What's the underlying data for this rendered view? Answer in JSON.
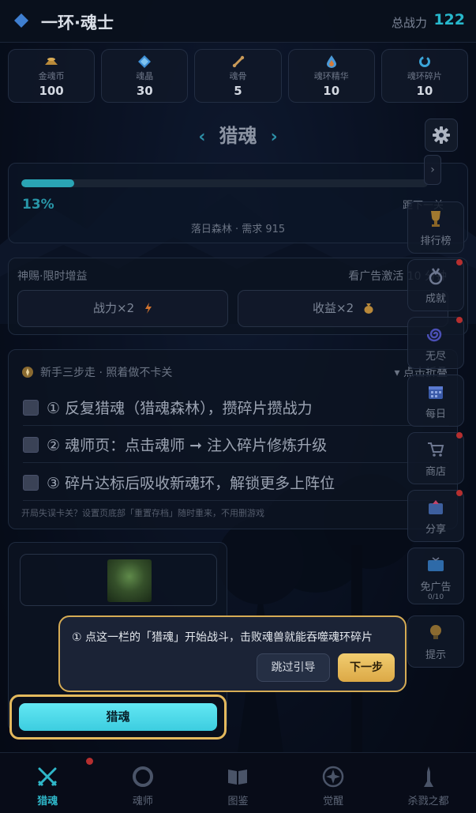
{
  "header": {
    "title": "一环·魂士",
    "power_label": "总战力",
    "power_value": "122"
  },
  "resources": [
    {
      "label": "金魂币",
      "value": "100",
      "icon": "coin-pile-icon"
    },
    {
      "label": "魂晶",
      "value": "30",
      "icon": "crystal-icon"
    },
    {
      "label": "魂骨",
      "value": "5",
      "icon": "bone-icon"
    },
    {
      "label": "魂环精华",
      "value": "10",
      "icon": "essence-drop-icon"
    },
    {
      "label": "魂环碎片",
      "value": "10",
      "icon": "ring-fragment-icon"
    }
  ],
  "hunt": {
    "title": "猎魂",
    "prev_arrow": "‹",
    "next_arrow": "›"
  },
  "progress": {
    "percent_text": "13%",
    "percent_value": 13,
    "next_label": "距下一关",
    "stage_info": "落日森林 · 需求 915"
  },
  "buff": {
    "title": "神赐·限时增益",
    "hint": "看广告激活 10 分钟",
    "power_btn": "战力×2",
    "income_btn": "收益×2"
  },
  "guide": {
    "title": "新手三步走 · 照着做不卡关",
    "fold_label": "▾ 点击折叠",
    "steps": [
      "① 反复猎魂（猎魂森林），攒碎片攒战力",
      "② 魂师页：点击魂师 ➞ 注入碎片修炼升级",
      "③ 碎片达标后吸收新魂环，解锁更多上阵位"
    ],
    "footnote": "开局失误卡关？设置页底部「重置存档」随时重来，不用删游戏"
  },
  "hunt_button": {
    "label": "猎魂"
  },
  "side_menu": [
    {
      "label": "排行榜",
      "icon": "trophy-icon"
    },
    {
      "label": "成就",
      "icon": "medal-icon"
    },
    {
      "label": "无尽",
      "icon": "spiral-icon"
    },
    {
      "label": "每日",
      "icon": "calendar-icon"
    },
    {
      "label": "商店",
      "icon": "cart-icon"
    },
    {
      "label": "分享",
      "icon": "share-icon"
    },
    {
      "label": "免广告",
      "sub": "0/10",
      "icon": "tv-icon"
    },
    {
      "label": "提示",
      "icon": "bulb-icon"
    }
  ],
  "tooltip": {
    "text": "① 点这一栏的「猎魂」开始战斗，击败魂兽就能吞噬魂环碎片",
    "skip_label": "跳过引导",
    "next_label": "下一步"
  },
  "bottom_nav": [
    {
      "label": "猎魂",
      "icon": "crossed-swords-icon",
      "active": true
    },
    {
      "label": "魂师",
      "icon": "ring-icon",
      "active": false
    },
    {
      "label": "图鉴",
      "icon": "book-icon",
      "active": false
    },
    {
      "label": "觉醒",
      "icon": "awaken-emblem-icon",
      "active": false
    },
    {
      "label": "杀戮之都",
      "icon": "tower-icon",
      "active": false
    }
  ],
  "colors": {
    "accent": "#2fb7c9",
    "gold": "#e4b95d",
    "background": "#0c1528"
  }
}
